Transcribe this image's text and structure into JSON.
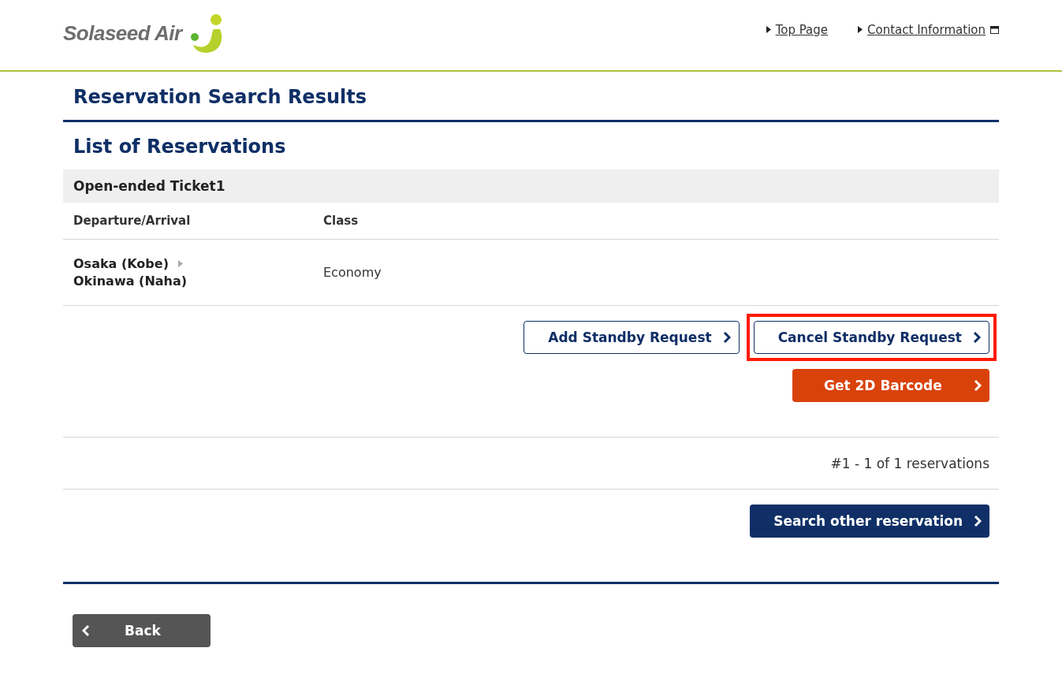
{
  "header": {
    "logo_text": "Solaseed Air",
    "links": [
      {
        "label": "Top Page",
        "external": false
      },
      {
        "label": "Contact Information",
        "external": true
      }
    ]
  },
  "page_title": "Reservation Search Results",
  "section_title": "List of Reservations",
  "ticket": {
    "name": "Open-ended Ticket1",
    "columns": [
      "Departure/Arrival",
      "Class"
    ],
    "rows": [
      {
        "departure": "Osaka (Kobe)",
        "arrival": "Okinawa (Naha)",
        "class": "Economy"
      }
    ],
    "actions": [
      [
        {
          "label": "Add Standby Request",
          "kind": "outline",
          "highlighted": false
        },
        {
          "label": "Cancel Standby Request",
          "kind": "outline",
          "highlighted": true
        }
      ],
      [
        {
          "label": "Get 2D Barcode",
          "kind": "orange",
          "highlighted": false
        }
      ]
    ]
  },
  "count": "#1 - 1 of 1 reservations",
  "search_button": {
    "label": "Search other reservation",
    "kind": "navy",
    "highlighted": false
  },
  "back_button": "Back"
}
